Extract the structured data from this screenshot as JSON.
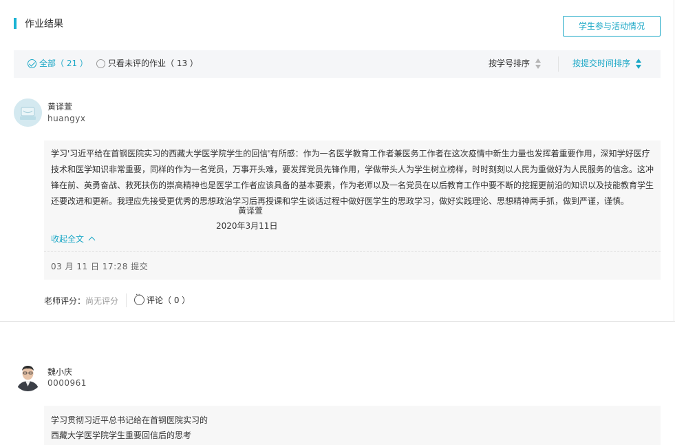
{
  "header": {
    "title": "作业结果",
    "activity_button": "学生参与活动情况"
  },
  "filters": {
    "all_label": "全部（ 21 ）",
    "unrated_label": "只看未评的作业（ 13 ）"
  },
  "sort": {
    "by_id": "按学号排序",
    "by_time": "按提交时间排序"
  },
  "accent_color": "#1aa7c6",
  "submissions": [
    {
      "name": "黄译萱",
      "user_id": "huangyx",
      "body": "学习'习近平给在首钢医院实习的西藏大学医学院学生的回信'有所感：作为一名医学教育工作者兼医务工作者在这次疫情中新生力量也发挥着重要作用，深知学好医疗技术和医学知识非常重要，同样的作为一名党员，万事开头难，要发挥党员先锋作用，学做带头人为学生树立榜样，时时刻刻以人民为重做好为人民服务的信念。这冲锋在前、英勇奋战、救死扶伤的崇高精神也是医学工作者应该具备的基本要素，作为老师以及一名党员在以后教育工作中要不断的挖掘更前沿的知识以及技能教育学生还要改进和更新。我理应先接受更优秀的思想政治学习后再授课和学生谈话过程中做好医学生的思政学习，做好实践理论、思想精神两手抓，做到严谨，谨慎。",
      "signature": "黄译萱",
      "signature_date": "2020年3月11日",
      "collapse_label": "收起全文",
      "submitted": "03 月 11 日 17:28 提交",
      "score_label": "老师评分：",
      "score_value": "尚无评分",
      "comment_label": "评论（ 0 ）"
    },
    {
      "name": "魏小庆",
      "user_id": "0000961",
      "line1": "学习贯彻习近平总书记给在首钢医院实习的",
      "line2": "西藏大学医学院学生重要回信后的思考"
    }
  ]
}
